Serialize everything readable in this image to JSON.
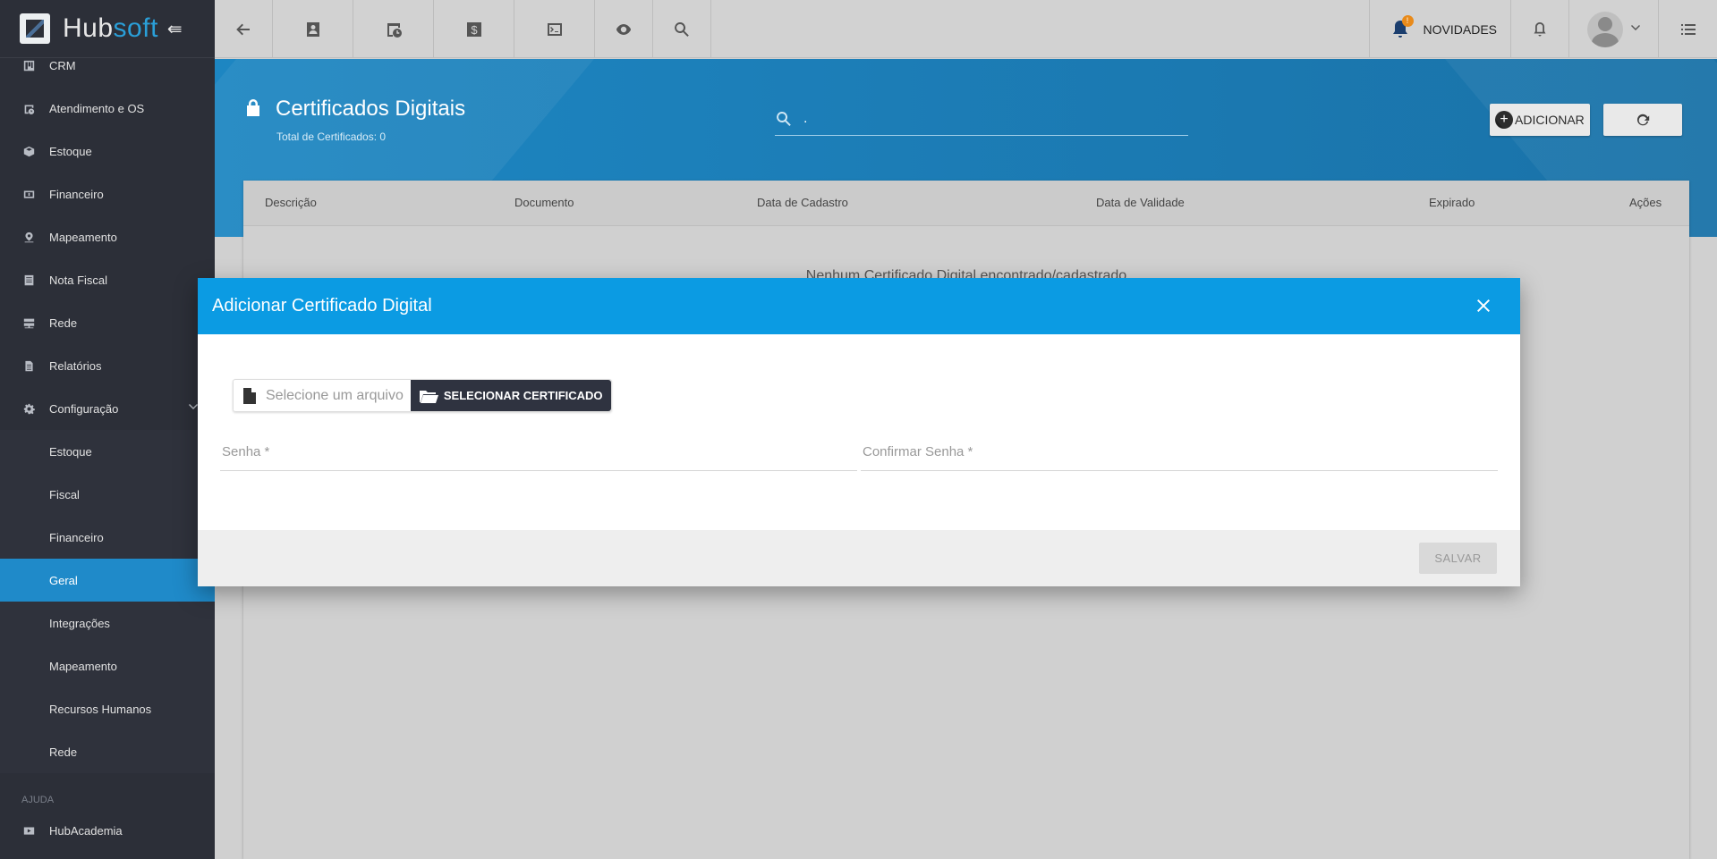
{
  "brand": {
    "name_a": "Hub",
    "name_b": "soft",
    "collapse_glyph": "⇚"
  },
  "sidebar": {
    "items": [
      {
        "label": "CRM",
        "icon": "board-icon"
      },
      {
        "label": "Atendimento e OS",
        "icon": "calendar-clock-icon"
      },
      {
        "label": "Estoque",
        "icon": "box-icon"
      },
      {
        "label": "Financeiro",
        "icon": "money-icon"
      },
      {
        "label": "Mapeamento",
        "icon": "map-pin-icon"
      },
      {
        "label": "Nota Fiscal",
        "icon": "receipt-icon"
      },
      {
        "label": "Rede",
        "icon": "server-icon"
      },
      {
        "label": "Relatórios",
        "icon": "document-icon"
      },
      {
        "label": "Configuração",
        "icon": "gear-icon"
      }
    ],
    "sub_items": [
      "Estoque",
      "Fiscal",
      "Financeiro",
      "Geral",
      "Integrações",
      "Mapeamento",
      "Recursos Humanos",
      "Rede"
    ],
    "active_sub": "Geral",
    "section_label": "AJUDA",
    "help_item": {
      "label": "HubAcademia",
      "icon": "youtube-icon"
    }
  },
  "topbar": {
    "news_label": "NOVIDADES",
    "news_badge": "!"
  },
  "page": {
    "title": "Certificados Digitais",
    "subtitle": "Total de Certificados: 0",
    "search_value": ".",
    "add_label": "ADICIONAR"
  },
  "table": {
    "columns": [
      "Descrição",
      "Documento",
      "Data de Cadastro",
      "Data de Validade",
      "Expirado",
      "Ações"
    ],
    "empty_message": "Nenhum Certificado Digital encontrado/cadastrado"
  },
  "modal": {
    "title": "Adicionar Certificado Digital",
    "file_placeholder": "Selecione um arquivo",
    "select_button": "SELECIONAR CERTIFICADO",
    "password_label": "Senha *",
    "confirm_label": "Confirmar Senha *",
    "save_label": "SALVAR"
  },
  "colors": {
    "sidebar_bg": "#2c2f38",
    "active": "#1f8ac9",
    "modal_header": "#0b9be3",
    "header_band": "#1d86c2"
  }
}
